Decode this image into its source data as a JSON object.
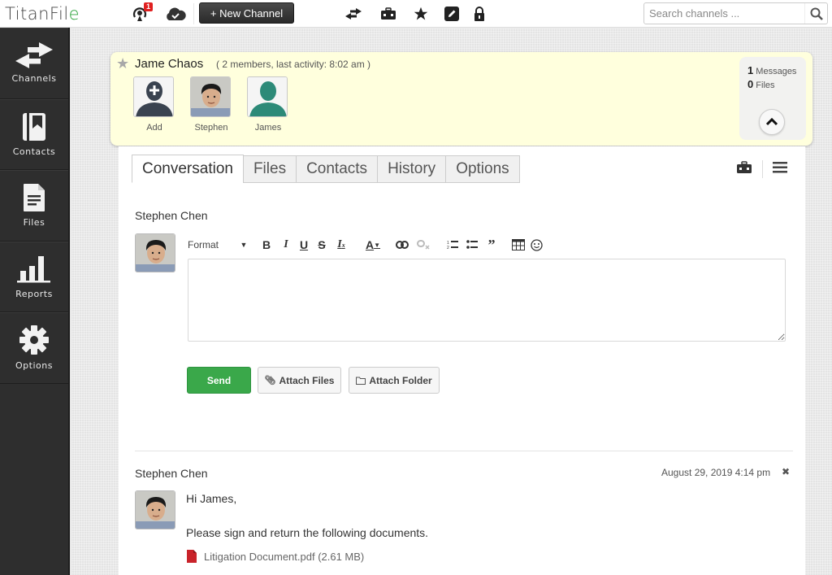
{
  "app": {
    "logo_text": "TitanFil",
    "logo_accent": "e",
    "notifications_count": "1",
    "new_channel_label": "+ New Channel",
    "search_placeholder": "Search channels ..."
  },
  "top_icons": [
    "broadcast-icon",
    "cloud-check-icon",
    "exchange-icon",
    "briefcase-icon",
    "star-icon",
    "edit-icon",
    "lock-icon"
  ],
  "sidebar": {
    "items": [
      {
        "label": "Channels",
        "icon": "exchange-icon"
      },
      {
        "label": "Contacts",
        "icon": "contact-book-icon"
      },
      {
        "label": "Files",
        "icon": "file-icon"
      },
      {
        "label": "Reports",
        "icon": "bar-chart-icon"
      },
      {
        "label": "Options",
        "icon": "gear-icon"
      }
    ]
  },
  "channel": {
    "title": "Jame Chaos",
    "meta": "( 2 members, last activity: 8:02 am )",
    "members": [
      {
        "name": "Add",
        "type": "add"
      },
      {
        "name": "Stephen",
        "type": "photo"
      },
      {
        "name": "James",
        "type": "placeholder"
      }
    ],
    "stats": {
      "messages_count": "1",
      "messages_label": "Messages",
      "files_count": "0",
      "files_label": "Files"
    }
  },
  "tabs": [
    {
      "label": "Conversation",
      "active": true
    },
    {
      "label": "Files",
      "active": false
    },
    {
      "label": "Contacts",
      "active": false
    },
    {
      "label": "History",
      "active": false
    },
    {
      "label": "Options",
      "active": false
    }
  ],
  "composer": {
    "author": "Stephen Chen",
    "format_label": "Format",
    "send_label": "Send",
    "attach_files_label": "Attach Files",
    "attach_folder_label": "Attach Folder",
    "editor_value": ""
  },
  "messages": [
    {
      "author": "Stephen Chen",
      "date": "August 29, 2019 4:14 pm",
      "lines": [
        "Hi James,",
        "Please sign and return the following documents."
      ],
      "attachment": "Litigation Document.pdf (2.61 MB)"
    }
  ],
  "colors": {
    "send_green": "#3aa84a",
    "header_yellow": "#ffffdd",
    "sidebar_dark": "#2e2e2e",
    "badge_red": "#e02020",
    "pdf_red": "#c9232a"
  }
}
